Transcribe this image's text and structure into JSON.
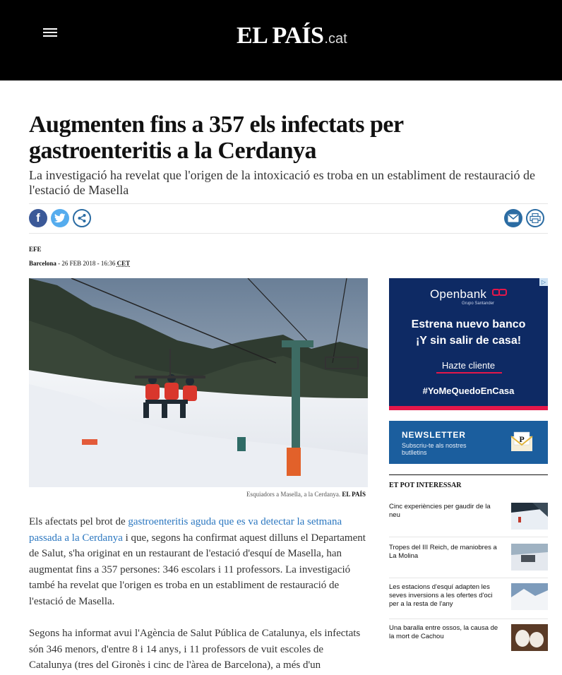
{
  "header": {
    "logo_main": "EL PAÍS",
    "logo_domain": ".cat"
  },
  "article": {
    "headline": "Augmenten fins a 357 els infectats per gastroenteritis a la Cerdanya",
    "subtitle": "La investigació ha revelat que l'origen de la intoxicació es troba en un establiment de restauració de l'estació de Masella",
    "author": "EFE",
    "location": "Barcelona",
    "date": "- 26 FEB 2018 - 16:36",
    "timezone": "CET",
    "photo_caption": "Esquiadors a Masella, a la Cerdanya.",
    "photo_credit": "EL PAÍS",
    "p1_before_link": "Els afectats pel brot de ",
    "p1_link": "gastroenteritis aguda que es va detectar la setmana passada a la Cerdanya",
    "p1_after_link": " i que, segons ha confirmat aquest dilluns el Departament de Salut, s'ha originat en un restaurant de l'estació d'esquí de Masella, han augmentat fins a 357 persones: 346 escolars i 11 professors. La investigació també ha revelat que l'origen es troba en un establiment de restauració de l'estació de Masella.",
    "p2": "Segons ha informat avui l'Agència de Salut Pública de Catalunya, els infectats són 346 menors, d'entre 8 i 14 anys, i 11 professors de vuit escoles de Catalunya (tres del Gironès i cinc de l'àrea de Barcelona), a més d'un"
  },
  "share": {
    "facebook_glyph": "f"
  },
  "ad_bank": {
    "corner": "▷",
    "brand": "Openbank",
    "brand_sub": "Grupo Santander",
    "line1": "Estrena nuevo banco",
    "line2": "¡Y sin salir de casa!",
    "cta": "Hazte cliente",
    "hashtag": "#YoMeQuedoEnCasa",
    "brand_color": "#0e2a64",
    "accent_color": "#e4174a"
  },
  "ad_newsletter": {
    "title": "NEWSLETTER",
    "subtitle": "Subscriu-te als nostres butlletins",
    "env_letter": "P"
  },
  "related": {
    "title": "ET POT INTERESSAR",
    "items": [
      {
        "text": "Cinc experiències per gaudir de la neu"
      },
      {
        "text": "Tropes del III Reich, de maniobres a La Molina"
      },
      {
        "text": "Les estacions d'esquí adapten les seves inversions a les ofertes d'oci per a la resta de l'any"
      },
      {
        "text": "Una baralla entre ossos, la causa de la mort de Cachou"
      }
    ]
  }
}
